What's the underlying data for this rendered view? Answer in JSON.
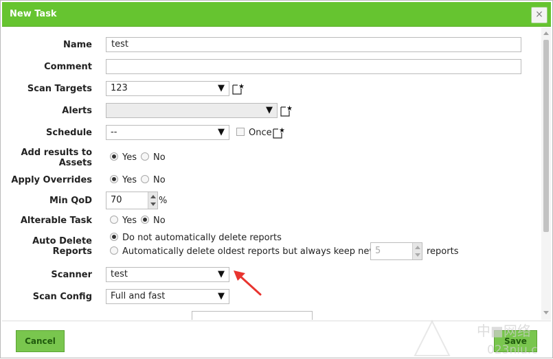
{
  "dialog": {
    "title": "New Task",
    "close_symbol": "×"
  },
  "form": {
    "name": {
      "label": "Name",
      "value": "test"
    },
    "comment": {
      "label": "Comment",
      "value": ""
    },
    "scan_targets": {
      "label": "Scan Targets",
      "selected": "123"
    },
    "alerts": {
      "label": "Alerts",
      "selected": ""
    },
    "schedule": {
      "label": "Schedule",
      "selected": "--",
      "once_label": "Once",
      "once_checked": false
    },
    "add_results": {
      "label_line1": "Add results to",
      "label_line2": "Assets",
      "yes": "Yes",
      "no": "No",
      "value": "yes"
    },
    "apply_overrides": {
      "label": "Apply Overrides",
      "yes": "Yes",
      "no": "No",
      "value": "yes"
    },
    "min_qod": {
      "label": "Min QoD",
      "value": "70",
      "unit": "%"
    },
    "alterable_task": {
      "label": "Alterable Task",
      "yes": "Yes",
      "no": "No",
      "value": "no"
    },
    "auto_delete": {
      "label_line1": "Auto Delete",
      "label_line2": "Reports",
      "option_1": "Do not automatically delete reports",
      "option_2": "Automatically delete oldest reports but always keep newest",
      "keep_value": "5",
      "keep_unit": "reports",
      "value": "option_1"
    },
    "scanner": {
      "label": "Scanner",
      "selected": "test"
    },
    "scan_config": {
      "label": "Scan Config",
      "selected": "Full and fast"
    }
  },
  "footer": {
    "cancel_label": "Cancel",
    "save_label": "Save"
  },
  "watermark": {
    "line1": "中■网络",
    "line2": "023niu.c"
  },
  "colors": {
    "title_bar": "#66c430",
    "button": "#79c64e",
    "annotation_arrow": "#e8342f"
  }
}
